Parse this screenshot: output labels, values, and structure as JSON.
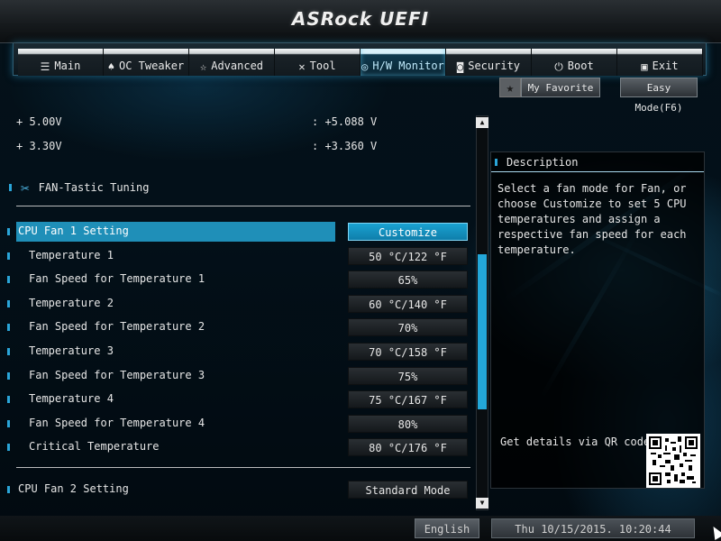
{
  "app": {
    "title": "ASRock UEFI"
  },
  "tabs": [
    {
      "label": "Main",
      "icon": "list-icon",
      "glyph": "☰",
      "active": false
    },
    {
      "label": "OC Tweaker",
      "icon": "flame-icon",
      "glyph": "♠",
      "active": false
    },
    {
      "label": "Advanced",
      "icon": "star-icon",
      "glyph": "☆",
      "active": false
    },
    {
      "label": "Tool",
      "icon": "tools-icon",
      "glyph": "✕",
      "active": false
    },
    {
      "label": "H/W Monitor",
      "icon": "globe-icon",
      "glyph": "◎",
      "active": true
    },
    {
      "label": "Security",
      "icon": "shield-icon",
      "glyph": "◙",
      "active": false
    },
    {
      "label": "Boot",
      "icon": "power-icon",
      "glyph": "⏻",
      "active": false
    },
    {
      "label": "Exit",
      "icon": "exit-icon",
      "glyph": "▣",
      "active": false
    }
  ],
  "favorites": {
    "star_glyph": "★",
    "my_favorite": "My Favorite",
    "easy_mode": "Easy Mode(F6)"
  },
  "voltages": [
    {
      "label": "+ 5.00V",
      "value": ": +5.088 V"
    },
    {
      "label": "+ 3.30V",
      "value": ": +3.360 V"
    }
  ],
  "section": {
    "title": "FAN-Tastic Tuning",
    "icon": "wrench-icon",
    "glyph": "✂"
  },
  "settings": [
    {
      "label": "CPU Fan 1 Setting",
      "value": "Customize",
      "selected": true,
      "top": true
    },
    {
      "label": "Temperature 1",
      "value": "50 °C/122 °F"
    },
    {
      "label": "Fan Speed for Temperature 1",
      "value": "65%"
    },
    {
      "label": "Temperature 2",
      "value": "60 °C/140 °F"
    },
    {
      "label": "Fan Speed for Temperature 2",
      "value": "70%"
    },
    {
      "label": "Temperature 3",
      "value": "70 °C/158 °F"
    },
    {
      "label": "Fan Speed for Temperature 3",
      "value": "75%"
    },
    {
      "label": "Temperature 4",
      "value": "75 °C/167 °F"
    },
    {
      "label": "Fan Speed for Temperature 4",
      "value": "80%"
    },
    {
      "label": "Critical Temperature",
      "value": "80 °C/176 °F"
    }
  ],
  "fan2": {
    "label": "CPU Fan 2 Setting",
    "value": "Standard Mode"
  },
  "description": {
    "title": "Description",
    "text": "Select a fan mode for Fan, or choose Customize to set 5 CPU temperatures and assign a respective fan speed for each temperature.",
    "qr_label": "Get details via QR code"
  },
  "status": {
    "language": "English",
    "datetime": "Thu 10/15/2015. 10:20:44"
  },
  "colors": {
    "accent": "#1f8fb8",
    "scroll": "#23a7d9"
  }
}
